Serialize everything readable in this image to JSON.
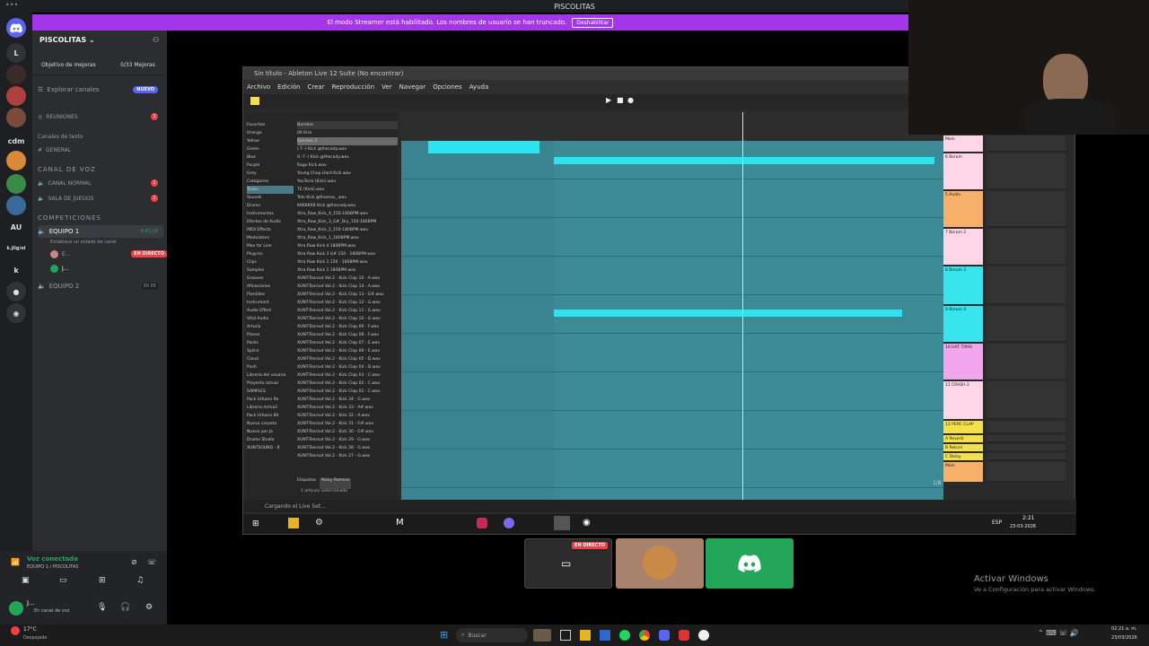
{
  "window": {
    "title": "PISCOLITAS"
  },
  "banner": {
    "text": "El modo Streamer está habilitado. Los nombres de usuario se han truncado.",
    "button": "Deshabilitar"
  },
  "rail": {
    "items": [
      "L",
      "cdm",
      "AU",
      "k.jlig/el",
      "k"
    ]
  },
  "server": {
    "name": "PISCOLITAS",
    "boost_label": "Objetivo de mejoras",
    "boost_value": "0/33 Mejoras",
    "explore": "Explorar canales",
    "explore_badge": "NUEVO",
    "reuniones": "REUNIONES",
    "text_cat": "Canales de texto",
    "general": "GENERAL",
    "voice_cat": "CANAL DE VOZ",
    "canal_normal": "CANAL NORMAL",
    "sala_juegos": "SALA DE JUEGOS",
    "comp_cat": "COMPETICIONES",
    "equipo1": "EQUIPO 1",
    "equipo1_time": "6:41:10",
    "equipo1_status": "Establece un estado de canal",
    "member1": "E...",
    "member1_badge": "EN DIRECTO",
    "member2": "J...",
    "equipo2": "EQUIPO 2",
    "equipo2_count": "00",
    "equipo2_count2": "05"
  },
  "voice": {
    "status": "Voz conectada",
    "channel": "EQUIPO 1 / PISCOLITAS",
    "user": "J...",
    "user_status": "En canal de voz"
  },
  "ableton": {
    "title": "Sin título - Ableton Live 12 Suite (No encontrar)",
    "menu": [
      "Archivo",
      "Edición",
      "Crear",
      "Reproducción",
      "Ver",
      "Navegar",
      "Opciones",
      "Ayuda"
    ],
    "browser_categories": [
      "Favoritos",
      "Orange",
      "Yellow",
      "Green",
      "Blue",
      "Purple",
      "Grey",
      "Categorías",
      "Todos",
      "Sounds",
      "Drums",
      "Instrumentos",
      "Efectos de Audio",
      "MIDI Effects",
      "Modulators",
      "Max for Live",
      "Plug-ins",
      "Clips",
      "Samples",
      "Grooves",
      "Afinaciones",
      "Plantillas",
      "Instrument",
      "Audio Effect",
      "Vital Audio",
      "Arturia",
      "Places",
      "Packs",
      "Splice",
      "Cloud",
      "Push",
      "Librería del usuario",
      "Proyecto actual",
      "SAMPLES",
      "Pack Urbano Re",
      "Librería rkima2",
      "Pack Urbano 60",
      "Nueva carpeta",
      "Nuevo por Ja",
      "Drums Studio",
      "XUNTSOUND - B"
    ],
    "browser_files": [
      "Nombre",
      "06 Kick",
      "Sonidos 3",
      "(·T··) Kick @thecady.wav",
      "0-·T··) Kick @thecady.wav",
      "Ragu Kick.wav",
      "Young Chop Hard Kick.wav",
      "YouTorio (Kick).wav",
      "TE (Kick).wav",
      "Tele Kick @thomas_.wav",
      "KKKKKKK Kick @thecady.wav",
      "Xtra_Raw_Kick_4_150-180BPM.wav",
      "Xtra_Raw_Kick_3_G#_Dry_150-180BPM",
      "Xtra_Raw_Kick_2_150-180BPM.wav",
      "Xtra_Raw_Kick_1_180BPM.wav",
      "Xtra Raw Kick 4 180BPM.wav",
      "Xtra Raw Kick 3 G# 150 - 180BPM.wav",
      "Xtra Raw Kick 1 150 - 180BPM.wav",
      "Xtra Raw Kick 1 180BPM.wav",
      "XUNT-Tesrout Vol.2 - Kick Clap 16 - A.wav",
      "XUNT-Tesrout Vol.2 - Kick Clap 14 - A.wav",
      "XUNT-Tesrout Vol.2 - Kick Clap 13 - G#.wav",
      "XUNT-Tesrout Vol.2 - Kick Clap 12 - G.wav",
      "XUNT-Tesrout Vol.2 - Kick Clap 11 - G.wav",
      "XUNT-Tesrout Vol.2 - Kick Clap 10 - G.wav",
      "XUNT-Tesrout Vol.2 - Kick Clap 09 - F.wav",
      "XUNT-Tesrout Vol.2 - Kick Clap 08 - F.wav",
      "XUNT-Tesrout Vol.2 - Kick Clap 07 - E.wav",
      "XUNT-Tesrout Vol.2 - Kick Clap 06 - E.wav",
      "XUNT-Tesrout Vol.2 - Kick Clap 05 - D.wav",
      "XUNT-Tesrout Vol.2 - Kick Clap 04 - D.wav",
      "XUNT-Tesrout Vol.2 - Kick Clap 03 - C.wav",
      "XUNT-Tesrout Vol.2 - Kick Clap 02 - C.wav",
      "XUNT-Tesrout Vol.2 - Kick Clap 01 - C.wav",
      "XUNT-Tesrout Vol.2 - Kick 34 - G.wav",
      "XUNT-Tesrout Vol.2 - Kick 33 - A#.wav",
      "XUNT-Tesrout Vol.2 - Kick 32 - A.wav",
      "XUNT-Tesrout Vol.2 - Kick 31 - G#.wav",
      "XUNT-Tesrout Vol.2 - Kick 30 - G#.wav",
      "XUNT-Tesrout Vol.2 - Kick 29 - G.wav",
      "XUNT-Tesrout Vol.2 - Kick 28 - G.wav",
      "XUNT-Tesrout Vol.2 - Kick 27 - G.wav"
    ],
    "browser_footer": "Etiquetas",
    "browser_footer2": "Nicky Romero",
    "browser_footer3": "1 artículo seleccionado",
    "status": "Cargando el Live Set...",
    "mixer_tracks": [
      "Main",
      "6 Bzrum",
      "5 Audio",
      "7 Bzrum 2",
      "8 Bzrum 3",
      "9 Bzrum 4",
      "10 HAT TIPAS",
      "11 CRASH 2",
      "12 PERC CLAP",
      "A Reverb",
      "B Return",
      "C Delay",
      "Main"
    ],
    "page_counter": "1/8",
    "clock": "2:21",
    "date": "23-03-2026",
    "lang": "ESP"
  },
  "participants": {
    "live_badge": "EN DIRECTO"
  },
  "activate": {
    "title": "Activar Windows",
    "sub": "Ve a Configuración para activar Windows."
  },
  "taskbar": {
    "weather_temp": "17°C",
    "weather": "Despejado",
    "search": "Buscar",
    "time": "02:21 a. m.",
    "date": "23/03/2026"
  }
}
